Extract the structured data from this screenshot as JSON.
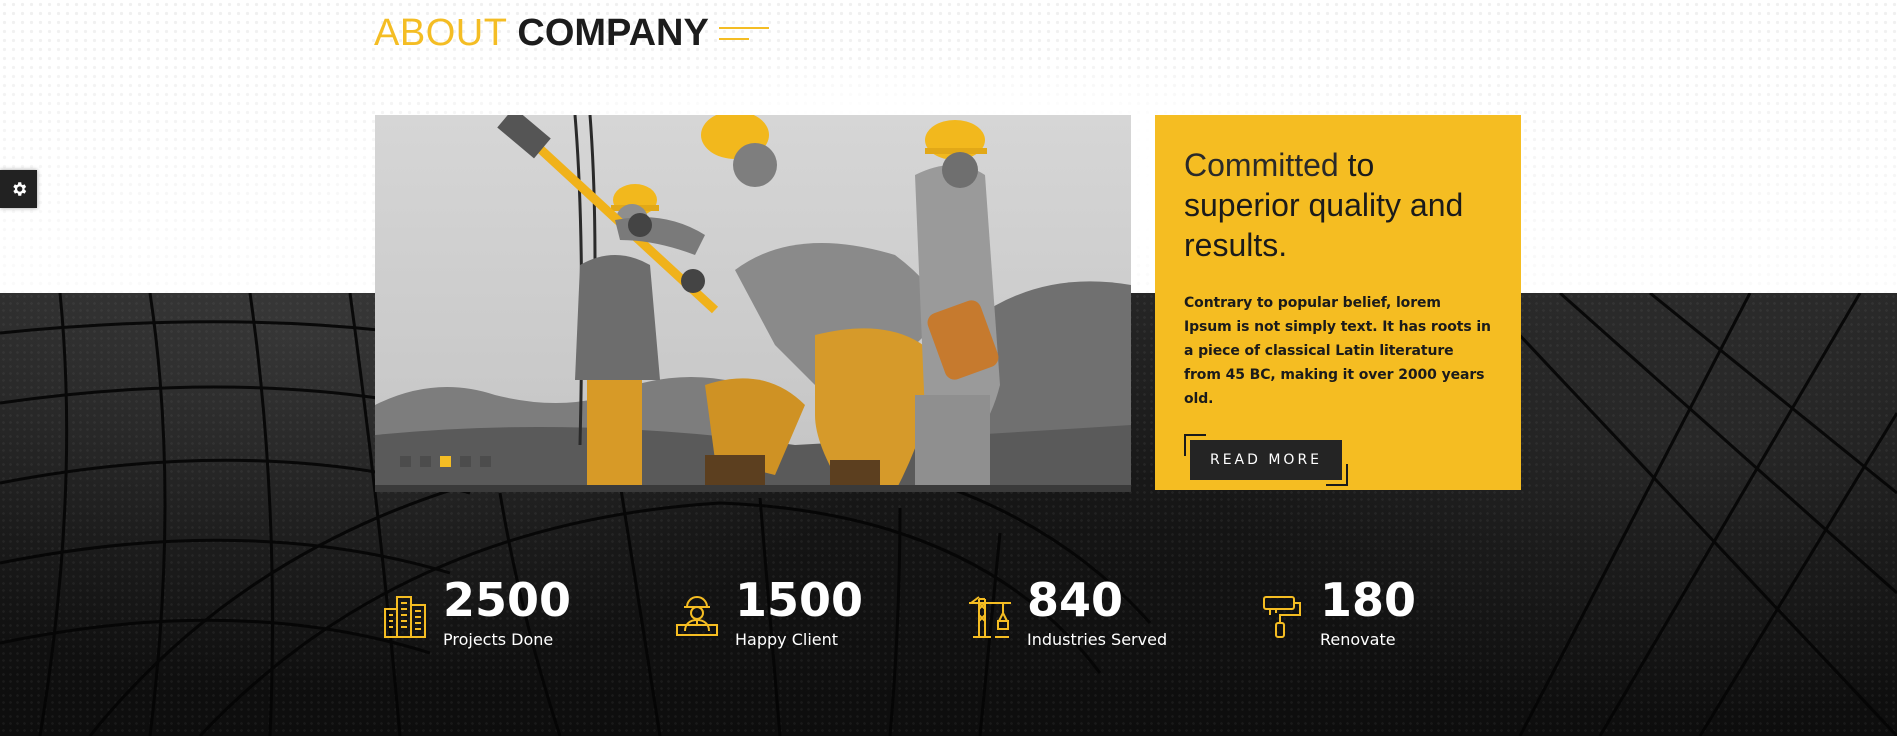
{
  "colors": {
    "accent": "#f5bd22",
    "dark": "#161616",
    "button_bg": "#242424",
    "text_dark": "#1b1b1b",
    "text_light": "#ffffff"
  },
  "settings": {
    "icon": "gear-icon"
  },
  "section": {
    "title_light": "ABOUT",
    "title_bold": "COMPANY"
  },
  "slider": {
    "image_subject": "construction workers in hard hats",
    "slide_count": 5,
    "active_slide": 3
  },
  "card": {
    "heading_light": "Committed",
    "heading_bold": "to superior quality and results.",
    "body": "Contrary to popular belief, lorem Ipsum is not simply text. It has roots in a piece of classical Latin literature from 45 BC, making it over 2000 years old.",
    "button_label": "READ MORE"
  },
  "stats": [
    {
      "icon": "buildings-icon",
      "number": "2500",
      "label": "Projects Done"
    },
    {
      "icon": "worker-icon",
      "number": "1500",
      "label": "Happy Client"
    },
    {
      "icon": "crane-icon",
      "number": "840",
      "label": "Industries Served"
    },
    {
      "icon": "paint-roller-icon",
      "number": "180",
      "label": "Renovate"
    }
  ]
}
